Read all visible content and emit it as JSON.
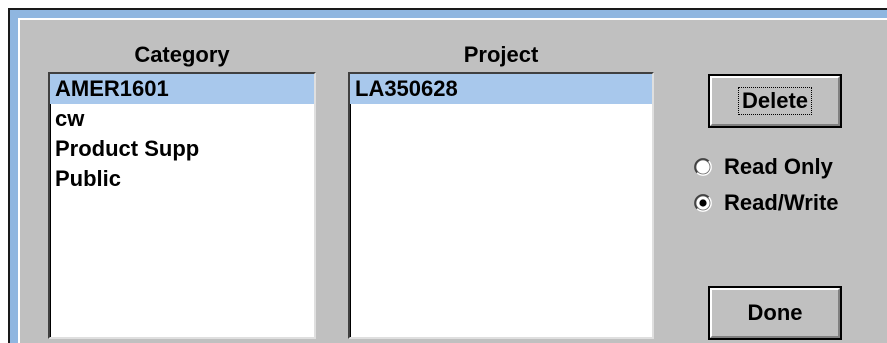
{
  "category": {
    "label": "Category",
    "items": [
      "AMER1601",
      "cw",
      "Product Supp",
      "Public"
    ],
    "selected_index": 0
  },
  "project": {
    "label": "Project",
    "items": [
      "LA350628"
    ],
    "selected_index": 0
  },
  "buttons": {
    "delete_label": "Delete",
    "done_label": "Done"
  },
  "access": {
    "read_only_label": "Read Only",
    "read_write_label": "Read/Write",
    "selected": "read_write"
  },
  "colors": {
    "dialog_bg": "#c0c0c0",
    "selection": "#a8c8ec",
    "frame_accent": "#8fb6e0"
  }
}
